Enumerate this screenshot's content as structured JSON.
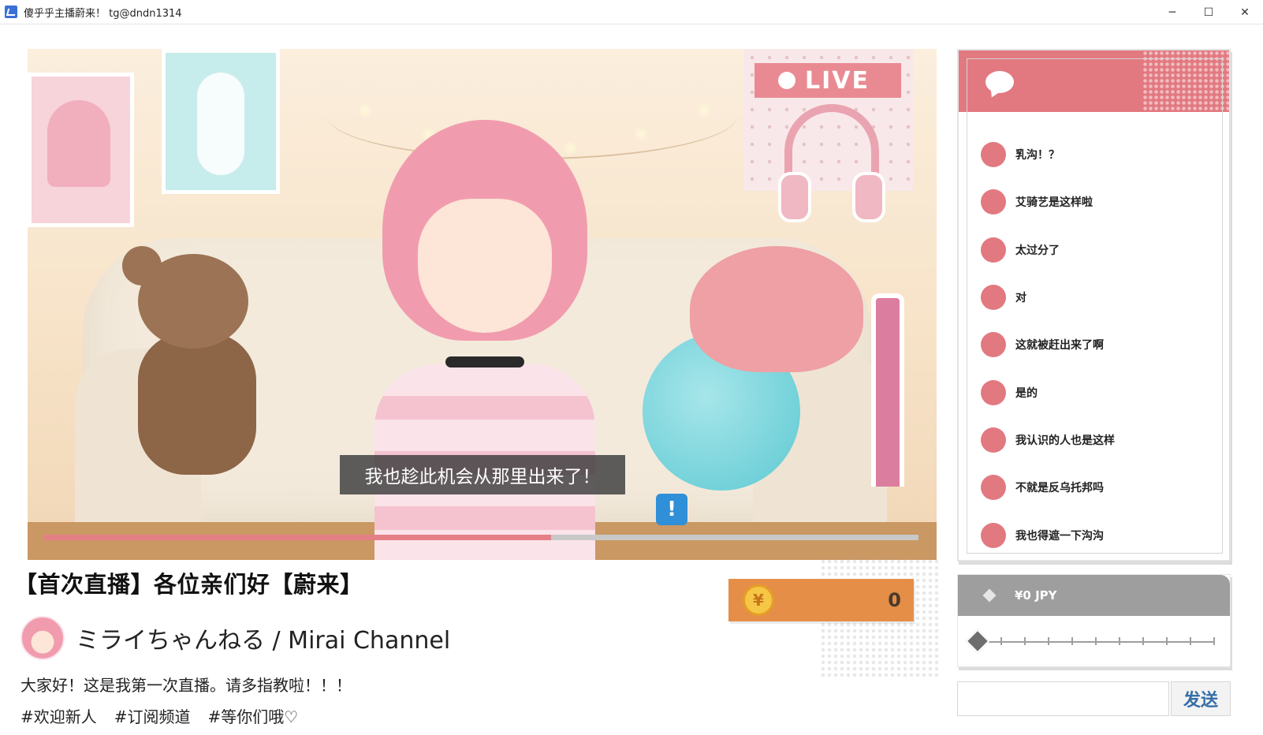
{
  "window": {
    "title": "傻乎乎主播蔚来！ tg@dndn1314",
    "minimize_glyph": "─",
    "maximize_glyph": "☐",
    "close_glyph": "✕"
  },
  "stage": {
    "live_label": "LIVE",
    "subtitle": "我也趁此机会从那里出来了！",
    "alert_glyph": "!",
    "progress": 0.58,
    "side_meter_level": 1.0
  },
  "stream": {
    "title": "【首次直播】各位亲们好【蔚来】",
    "channel_name": "ミライちゃんねる / Mirai Channel",
    "description": "大家好！这是我第一次直播。请多指教啦！！！",
    "tags": [
      "#欢迎新人",
      "#订阅频道",
      "#等你们哦♡"
    ]
  },
  "coins": {
    "symbol": "¥",
    "value": "0"
  },
  "chat": {
    "messages": [
      "乳沟！？",
      "艾骑艺是这样啦",
      "太过分了",
      "对",
      "这就被赶出来了啊",
      "是的",
      "我认识的人也是这样",
      "不就是反乌托邦吗",
      "我也得遮一下沟沟"
    ]
  },
  "tip": {
    "amount_label": "¥0 JPY",
    "slider_value": 0
  },
  "send": {
    "input_value": "",
    "button_label": "发送"
  },
  "colors": {
    "accent_pink": "#e27980",
    "coin_orange": "#e58e48",
    "send_blue": "#356fa8",
    "progress_red": "#e57f86"
  }
}
